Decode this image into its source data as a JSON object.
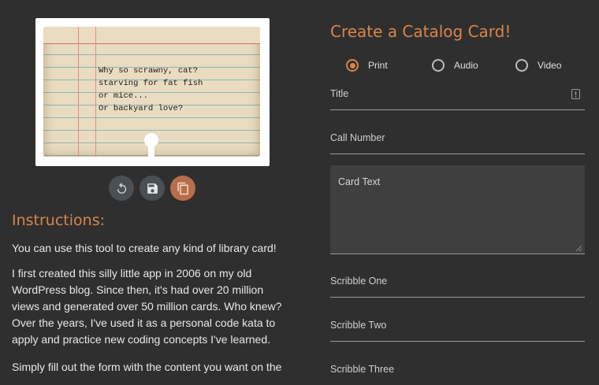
{
  "card": {
    "text": "Why so scrawny, cat?\nstarving for fat fish\nor mice...\nOr backyard love?"
  },
  "actions": {
    "reset": {
      "icon": "reset-icon"
    },
    "save": {
      "icon": "save-icon"
    },
    "copy": {
      "icon": "copy-icon"
    }
  },
  "instructions": {
    "title": "Instructions:",
    "paragraphs": [
      "You can use this tool to create any kind of library card!",
      "I first created this silly little app in 2006 on my old WordPress blog. Since then, it's had over 20 million views and generated over 50 million cards. Who knew? Over the years, I've used it as a personal code kata to apply and practice new coding concepts I've learned.",
      "Simply fill out the form with the content you want on the"
    ]
  },
  "form": {
    "title": "Create a Catalog Card!",
    "media_types": [
      {
        "label": "Print",
        "selected": true
      },
      {
        "label": "Audio",
        "selected": false
      },
      {
        "label": "Video",
        "selected": false
      }
    ],
    "fields": {
      "title": "Title",
      "call_number": "Call Number",
      "card_text": "Card Text",
      "scribble_one": "Scribble One",
      "scribble_two": "Scribble Two",
      "scribble_three": "Scribble Three"
    }
  },
  "colors": {
    "background": "#2f2f2f",
    "accent": "#d9854a",
    "copy_button": "#b86e4a"
  }
}
